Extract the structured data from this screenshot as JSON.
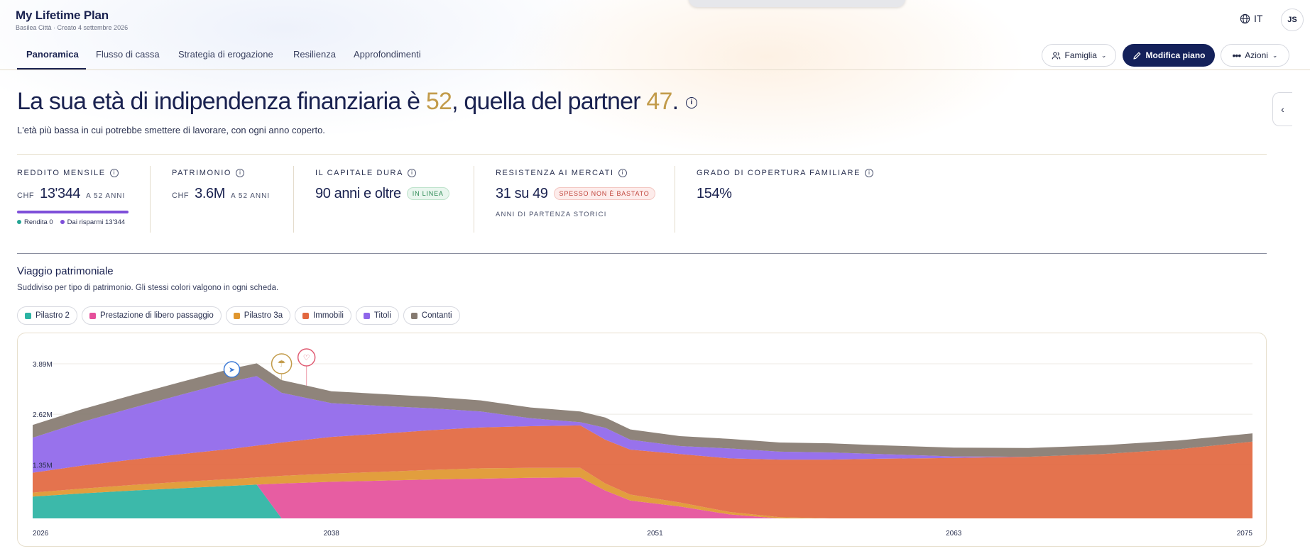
{
  "app": {
    "title": "My Lifetime Plan",
    "subtitle": "Basilea Città · Creato 4 settembre 2026",
    "language": "IT",
    "avatar_initials": "JS"
  },
  "nav": {
    "tabs": [
      "Panoramica",
      "Flusso di cassa",
      "Strategia di erogazione",
      "Resilienza",
      "Approfondimenti"
    ],
    "active_tab": "Panoramica",
    "family_label": "Famiglia",
    "edit_label": "Modifica piano",
    "actions_label": "Azioni"
  },
  "hero": {
    "prefix": "La sua età di indipendenza finanziaria è ",
    "age_self": "52",
    "middle": ", quella del partner ",
    "age_partner": "47",
    "suffix": ".",
    "subtitle": "L'età più bassa in cui potrebbe smettere di lavorare, con ogni anno coperto."
  },
  "kpis": {
    "income": {
      "label": "REDDITO MENSILE",
      "currency": "CHF",
      "value": "13'344",
      "qualifier": "A 52 ANNI",
      "legend": [
        {
          "label": "Rendita 0",
          "color": "#25a493"
        },
        {
          "label": "Dai risparmi 13'344",
          "color": "#7e4fd9"
        }
      ],
      "savings_share": 1.0
    },
    "wealth": {
      "label": "PATRIMONIO",
      "currency": "CHF",
      "value": "3.6M",
      "qualifier": "A 52 ANNI"
    },
    "duration": {
      "label": "IL CAPITALE DURA",
      "value": "90 anni e oltre",
      "badge": "IN LINEA"
    },
    "resilience": {
      "label": "RESISTENZA AI MERCATI",
      "value": "31 su 49",
      "badge": "SPESSO NON È BASTATO",
      "note": "ANNI DI PARTENZA STORICI"
    },
    "coverage": {
      "label": "GRADO DI COPERTURA FAMILIARE",
      "value": "154%"
    }
  },
  "section": {
    "title": "Viaggio patrimoniale",
    "subtitle": "Suddiviso per tipo di patrimonio. Gli stessi colori valgono in ogni scheda.",
    "chips": [
      {
        "label": "Pilastro 2",
        "color": "#2bb3a3"
      },
      {
        "label": "Prestazione di libero passaggio",
        "color": "#e54f9a"
      },
      {
        "label": "Pilastro 3a",
        "color": "#e0962e"
      },
      {
        "label": "Immobili",
        "color": "#e2673f"
      },
      {
        "label": "Titoli",
        "color": "#8f66ea"
      },
      {
        "label": "Contanti",
        "color": "#857a70"
      }
    ]
  },
  "chart_data": {
    "type": "area",
    "stacked": true,
    "x": [
      2026,
      2028,
      2030,
      2032,
      2034,
      2035,
      2036,
      2037,
      2038,
      2040,
      2042,
      2044,
      2046,
      2048,
      2049,
      2050,
      2052,
      2054,
      2056,
      2058,
      2060,
      2063,
      2066,
      2069,
      2072,
      2075
    ],
    "x_ticks": [
      "2026",
      "2038",
      "2051",
      "2063",
      "2075"
    ],
    "y_ticks": [
      "1.35M",
      "2.62M",
      "3.89M"
    ],
    "ylim": [
      0,
      3.89
    ],
    "grid": true,
    "series": [
      {
        "name": "Pilastro 2",
        "color": "#2bb3a3",
        "values": [
          0.55,
          0.63,
          0.7,
          0.76,
          0.82,
          0.85,
          0.0,
          0,
          0,
          0,
          0,
          0,
          0,
          0,
          0,
          0,
          0,
          0,
          0,
          0,
          0,
          0,
          0,
          0,
          0,
          0
        ]
      },
      {
        "name": "Prestazione di libero passaggio",
        "color": "#e54f9a",
        "values": [
          0,
          0,
          0,
          0,
          0,
          0,
          0.88,
          0.9,
          0.92,
          0.95,
          0.98,
          1.0,
          1.02,
          1.03,
          0.7,
          0.45,
          0.3,
          0.1,
          0,
          0,
          0,
          0,
          0,
          0,
          0,
          0
        ]
      },
      {
        "name": "Pilastro 3a",
        "color": "#e0962e",
        "values": [
          0.1,
          0.12,
          0.14,
          0.16,
          0.17,
          0.18,
          0.19,
          0.2,
          0.21,
          0.22,
          0.24,
          0.26,
          0.25,
          0.24,
          0.18,
          0.15,
          0.1,
          0.06,
          0.03,
          0,
          0,
          0,
          0,
          0,
          0,
          0
        ]
      },
      {
        "name": "Immobili",
        "color": "#e2673f",
        "values": [
          0.5,
          0.58,
          0.64,
          0.7,
          0.76,
          0.8,
          0.84,
          0.88,
          0.92,
          0.96,
          1.0,
          1.03,
          1.05,
          1.07,
          1.1,
          1.13,
          1.22,
          1.35,
          1.45,
          1.48,
          1.5,
          1.52,
          1.55,
          1.62,
          1.74,
          1.93
        ]
      },
      {
        "name": "Titoli",
        "color": "#8f66ea",
        "values": [
          0.88,
          1.1,
          1.3,
          1.5,
          1.7,
          1.75,
          1.25,
          1.05,
          0.85,
          0.7,
          0.55,
          0.4,
          0.2,
          0.08,
          0.3,
          0.25,
          0.2,
          0.25,
          0.2,
          0.18,
          0.12,
          0.04,
          0.0,
          0,
          0,
          0
        ]
      },
      {
        "name": "Contanti",
        "color": "#857a70",
        "values": [
          0.32,
          0.32,
          0.32,
          0.32,
          0.32,
          0.32,
          0.32,
          0.31,
          0.3,
          0.3,
          0.29,
          0.28,
          0.27,
          0.27,
          0.26,
          0.26,
          0.25,
          0.24,
          0.23,
          0.23,
          0.22,
          0.22,
          0.22,
          0.22,
          0.22,
          0.21
        ]
      }
    ],
    "milestones": [
      {
        "icon": "plane-icon",
        "year": 2034,
        "color": "#3d7ad6"
      },
      {
        "icon": "umbrella-icon",
        "year": 2036,
        "color": "#c29b4a"
      },
      {
        "icon": "heart-icon",
        "year": 2037,
        "color": "#e05c73"
      }
    ]
  }
}
